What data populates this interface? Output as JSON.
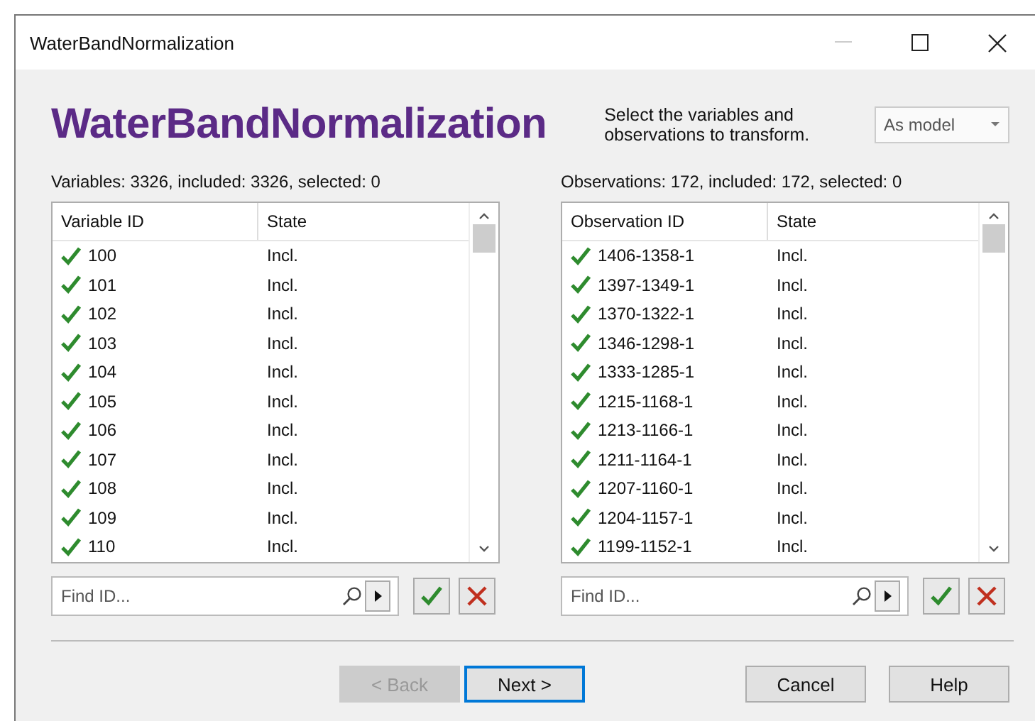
{
  "window": {
    "title": "WaterBandNormalization"
  },
  "heading": "WaterBandNormalization",
  "description": "Select the variables and observations to transform.",
  "dropdown": {
    "value": "As model"
  },
  "panels": [
    {
      "summary": "Variables: 3326, included: 3326, selected: 0",
      "columns": [
        "Variable ID",
        "State"
      ],
      "search": {
        "placeholder": "Find ID..."
      },
      "rows": [
        {
          "id": "100",
          "state": "Incl.",
          "included": true
        },
        {
          "id": "101",
          "state": "Incl.",
          "included": true
        },
        {
          "id": "102",
          "state": "Incl.",
          "included": true
        },
        {
          "id": "103",
          "state": "Incl.",
          "included": true
        },
        {
          "id": "104",
          "state": "Incl.",
          "included": true
        },
        {
          "id": "105",
          "state": "Incl.",
          "included": true
        },
        {
          "id": "106",
          "state": "Incl.",
          "included": true
        },
        {
          "id": "107",
          "state": "Incl.",
          "included": true
        },
        {
          "id": "108",
          "state": "Incl.",
          "included": true
        },
        {
          "id": "109",
          "state": "Incl.",
          "included": true
        },
        {
          "id": "110",
          "state": "Incl.",
          "included": true
        }
      ]
    },
    {
      "summary": "Observations: 172, included: 172, selected: 0",
      "columns": [
        "Observation ID",
        "State"
      ],
      "search": {
        "placeholder": "Find ID..."
      },
      "rows": [
        {
          "id": "1406-1358-1",
          "state": "Incl.",
          "included": true
        },
        {
          "id": "1397-1349-1",
          "state": "Incl.",
          "included": true
        },
        {
          "id": "1370-1322-1",
          "state": "Incl.",
          "included": true
        },
        {
          "id": "1346-1298-1",
          "state": "Incl.",
          "included": true
        },
        {
          "id": "1333-1285-1",
          "state": "Incl.",
          "included": true
        },
        {
          "id": "1215-1168-1",
          "state": "Incl.",
          "included": true
        },
        {
          "id": "1213-1166-1",
          "state": "Incl.",
          "included": true
        },
        {
          "id": "1211-1164-1",
          "state": "Incl.",
          "included": true
        },
        {
          "id": "1207-1160-1",
          "state": "Incl.",
          "included": true
        },
        {
          "id": "1204-1157-1",
          "state": "Incl.",
          "included": true
        },
        {
          "id": "1199-1152-1",
          "state": "Incl.",
          "included": true
        }
      ]
    }
  ],
  "buttons": [
    {
      "label": "< Back",
      "disabled": true,
      "default": false
    },
    {
      "label": "Next >",
      "disabled": false,
      "default": true
    },
    {
      "label": "Cancel",
      "disabled": false,
      "default": false
    },
    {
      "label": "Help",
      "disabled": false,
      "default": false
    }
  ]
}
